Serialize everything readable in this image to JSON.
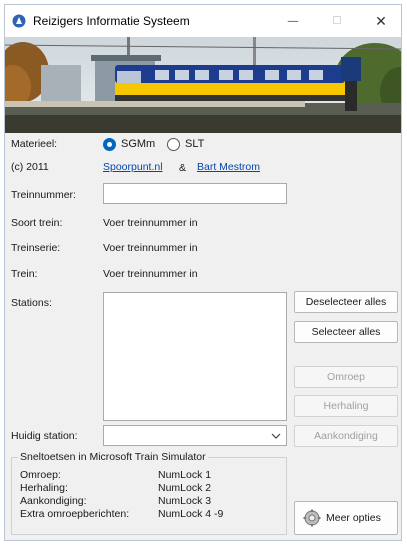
{
  "window": {
    "title": "Reizigers Informatie Systeem",
    "minimize_glyph": "—",
    "maximize_glyph": "☐",
    "close_glyph": "✕"
  },
  "materieel": {
    "label": "Materieel:",
    "options": [
      {
        "label": "SGMm",
        "selected": true
      },
      {
        "label": "SLT",
        "selected": false
      }
    ]
  },
  "credits": {
    "copyright": "(c) 2011",
    "link1": "Spoorpunt.nl",
    "separator": "&",
    "link2": "Bart Mestrom"
  },
  "fields": {
    "treinnummer_label": "Treinnummer:",
    "treinnummer_value": "",
    "soort_trein_label": "Soort trein:",
    "soort_trein_value": "Voer treinnummer in",
    "treinserie_label": "Treinserie:",
    "treinserie_value": "Voer treinnummer in",
    "trein_label": "Trein:",
    "trein_value": "Voer treinnummer in",
    "stations_label": "Stations:",
    "huidig_station_label": "Huidig station:",
    "huidig_station_value": ""
  },
  "buttons": {
    "deselecteer": "Deselecteer alles",
    "selecteer": "Selecteer alles",
    "omroep": "Omroep",
    "herhaling": "Herhaling",
    "aankondiging": "Aankondiging",
    "meer_opties": "Meer opties"
  },
  "shortcuts": {
    "title": "Sneltoetsen in Microsoft Train Simulator",
    "rows": [
      {
        "action": "Omroep:",
        "key": "NumLock 1"
      },
      {
        "action": "Herhaling:",
        "key": "NumLock 2"
      },
      {
        "action": "Aankondiging:",
        "key": "NumLock 3"
      },
      {
        "action": "Extra omroepberichten:",
        "key": "NumLock 4 -9"
      }
    ]
  },
  "icons": {
    "app": "train-app-icon",
    "settings": "gear-icon",
    "dropdown": "chevron-down-icon"
  },
  "colors": {
    "accent": "#0067c0",
    "link": "#0645ad",
    "window_bg": "#f0f0f0"
  }
}
